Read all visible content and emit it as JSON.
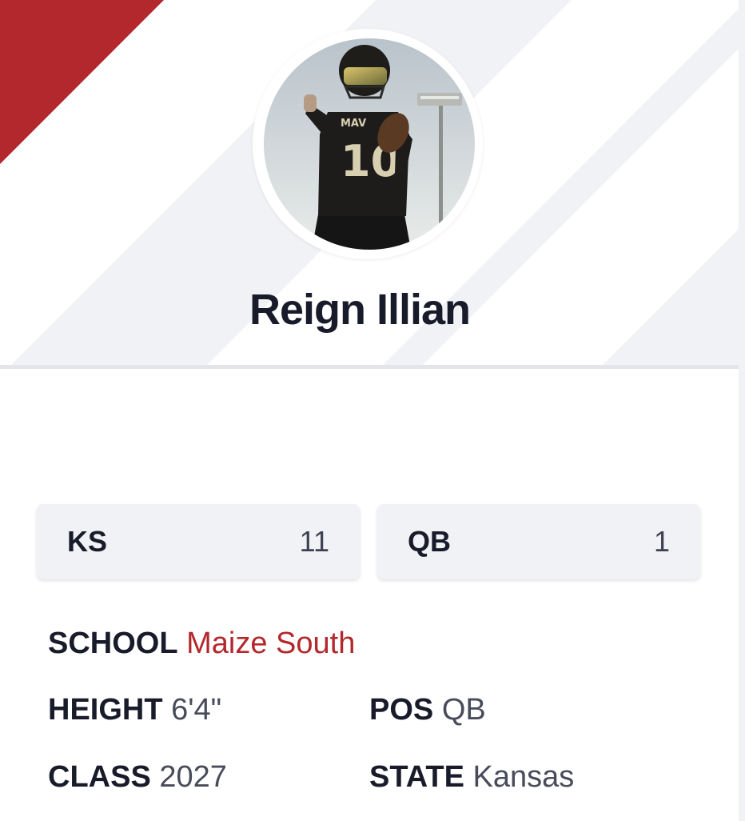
{
  "profile": {
    "name": "Reign Illian",
    "avatar_alt": "player-photo"
  },
  "ranks": [
    {
      "label": "KS",
      "value": "11"
    },
    {
      "label": "QB",
      "value": "1"
    }
  ],
  "details": {
    "school": {
      "label": "SCHOOL",
      "value": "Maize South"
    },
    "height": {
      "label": "HEIGHT",
      "value": "6'4\""
    },
    "pos": {
      "label": "POS",
      "value": "QB"
    },
    "class": {
      "label": "CLASS",
      "value": "2027"
    },
    "state": {
      "label": "STATE",
      "value": "Kansas"
    }
  },
  "colors": {
    "accent": "#b3282d",
    "header_bg": "#f1f2f5",
    "stripe": "#ffffff",
    "text_dark": "#181b2a",
    "text_muted": "#474b5a"
  }
}
